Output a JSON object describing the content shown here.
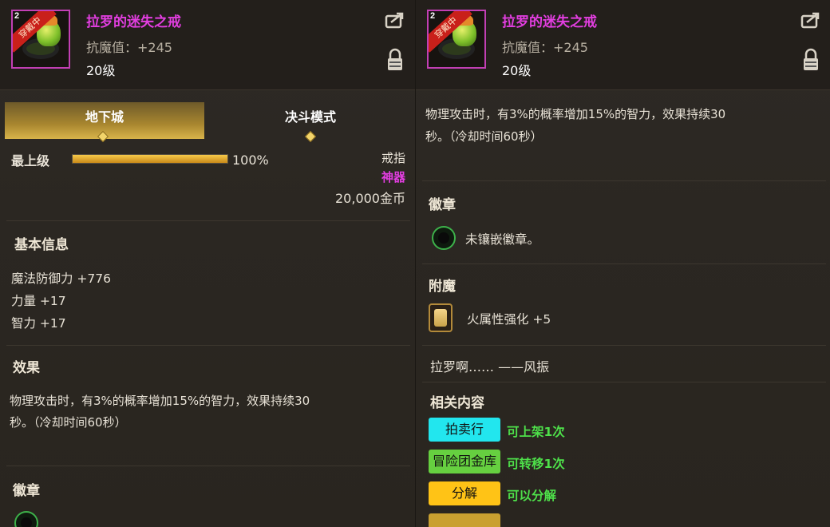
{
  "item": {
    "name": "拉罗的迷失之戒",
    "stat": "抗魔值：+245",
    "level": "20级",
    "badge_level": "2",
    "ribbon": "穿戴中"
  },
  "tabs": [
    {
      "label": "地下城",
      "active": true
    },
    {
      "label": "决斗模式",
      "active": false
    }
  ],
  "upgrade": {
    "label": "最上级",
    "percent_text": "100%",
    "percent": 100
  },
  "meta": {
    "slot": "戒指",
    "rarity": "神器",
    "price": "20,000金币"
  },
  "basic_info": {
    "title": "基本信息",
    "lines": [
      "魔法防御力 +776",
      "力量 +17",
      "智力 +17"
    ]
  },
  "effect": {
    "title": "效果",
    "line1": "物理攻击时，有3%的概率增加15%的智力，效果持续30",
    "line2": "秒。（冷却时间60秒）"
  },
  "emblem": {
    "title": "徽章",
    "empty_text": "未镶嵌徽章。"
  },
  "enchant": {
    "title": "附魔",
    "text": "火属性强化 +5"
  },
  "flavor": "拉罗啊……  ——风振",
  "related": {
    "title": "相关内容",
    "items": [
      {
        "label": "拍卖行",
        "note": "可上架1次",
        "color": "#22e6ee"
      },
      {
        "label": "冒险团金库",
        "note": "可转移1次",
        "color": "#66d040"
      },
      {
        "label": "分解",
        "note": "可以分解",
        "color": "#ffc316"
      }
    ],
    "note_color": "#4ee04a"
  },
  "colors": {
    "item_name": "#e23ee0",
    "rarity": "#e23ee0",
    "accent_gold": "#d8b44a"
  }
}
